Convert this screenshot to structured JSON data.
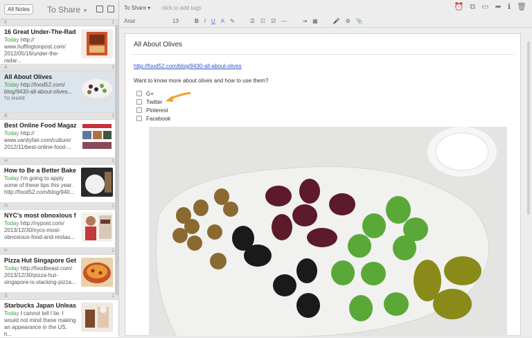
{
  "leftpane": {
    "all_notes": "All Notes",
    "notebook": "To Share",
    "sections": [
      "#",
      "A",
      "B",
      "H",
      "N",
      "P",
      "S"
    ],
    "count_mark": "1"
  },
  "notes": [
    {
      "title": "16 Great Under-The-Rad...",
      "today": "Today",
      "snippet": "http://\nwww.huffingtonpost.com/\n2012/05/16/under-the-radar...",
      "tag": ""
    },
    {
      "title": "All About Olives",
      "today": "Today",
      "snippet": "http://food52.com/\nblog/9430-all-about-olives...",
      "tag": "TO SHARE"
    },
    {
      "title": "Best Online Food Magaz...",
      "today": "Today",
      "snippet": "http://\nwww.vanityfair.com/culture/\n2012/11/best-online-food-...",
      "tag": ""
    },
    {
      "title": "How to Be a Better Bake...",
      "today": "Today",
      "snippet": "I'm going to apply\nsome of these tips this year.\nhttp://food52.com/blog/940...",
      "tag": ""
    },
    {
      "title": "NYC's most obnoxious f...",
      "today": "Today",
      "snippet": "http://nypost.com/\n2013/12/30/nycs-most-\nobnoxious-food-and-restau...",
      "tag": ""
    },
    {
      "title": "Pizza Hut Singapore Get...",
      "today": "Today",
      "snippet": "http://foodbeast.com/\n2013/12/30/pizza-hut-\nsingapore-is-stacking-pizza...",
      "tag": ""
    },
    {
      "title": "Starbucks Japan Unleas...",
      "today": "Today",
      "snippet": "I cannot tell I lie. I\nwould not mind these making\nan appearance in the US. h...",
      "tag": ""
    }
  ],
  "editor": {
    "notebook": "To Share",
    "tags_placeholder": "click to add tags",
    "font": "Arial",
    "size": "13",
    "title": "All About Olives",
    "link": "http://food52.com/blog/9430-all-about-olives",
    "question": "Want to know more about olives and how to use them?",
    "checklist": [
      "G+",
      "Twitter",
      "Pinterest",
      "Facebook"
    ]
  },
  "colors": {
    "accent": "#3aa040",
    "arrow": "#f0a030",
    "link": "#2a54c8"
  }
}
